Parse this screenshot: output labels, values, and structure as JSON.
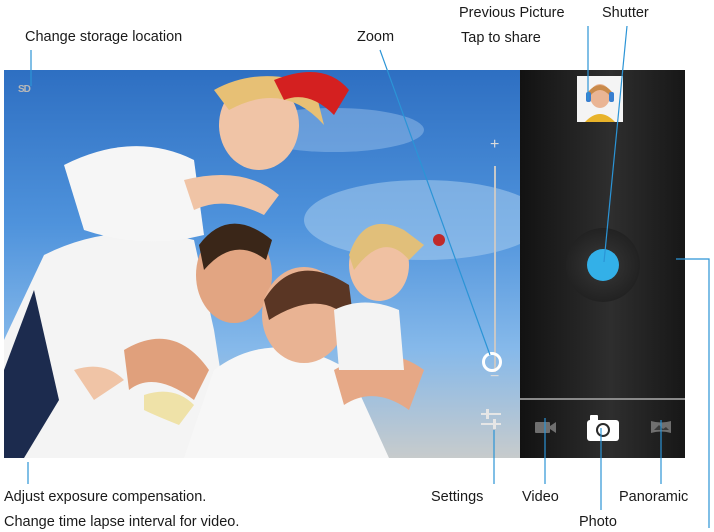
{
  "callouts": {
    "storage": "Change storage location",
    "zoom": "Zoom",
    "previous_picture": "Previous Picture",
    "tap_to_share": "Tap to share",
    "shutter": "Shutter",
    "exposure": "Adjust exposure compensation.",
    "time_lapse": "Change time lapse interval for video.",
    "settings": "Settings",
    "video": "Video",
    "panoramic": "Panoramic",
    "photo": "Photo"
  },
  "viewfinder": {
    "storage_indicator": "SD",
    "zoom_plus": "+",
    "zoom_minus": "−",
    "zoom_level": 0.05,
    "settings_icon": "sliders-icon"
  },
  "controls": {
    "shutter_color": "#33b0e8",
    "modes": [
      "video-camera-icon",
      "photo-camera-icon",
      "panorama-icon"
    ],
    "selected_mode": "Photo"
  }
}
